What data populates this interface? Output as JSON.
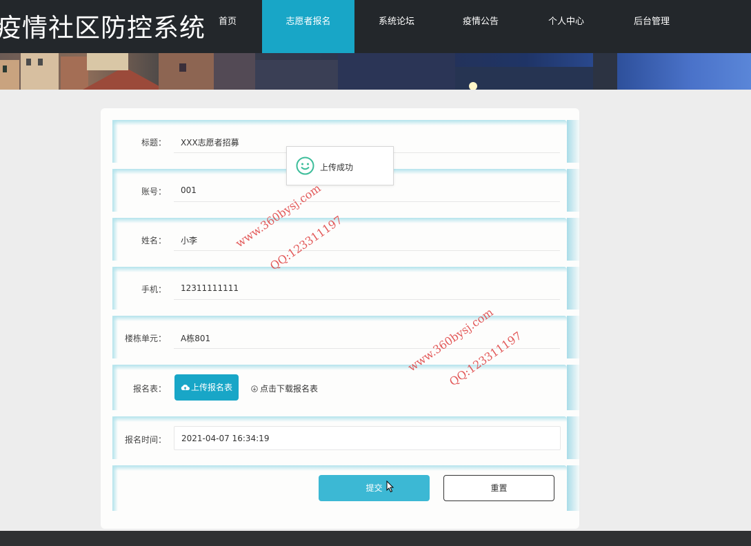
{
  "header": {
    "site_title": "疫情社区防控系统",
    "nav": [
      {
        "label": "首页",
        "active": false
      },
      {
        "label": "志愿者报名",
        "active": true
      },
      {
        "label": "系统论坛",
        "active": false
      },
      {
        "label": "疫情公告",
        "active": false
      },
      {
        "label": "个人中心",
        "active": false
      },
      {
        "label": "后台管理",
        "active": false
      }
    ]
  },
  "form": {
    "title": {
      "label": "标题：",
      "value": "XXX志愿者招募"
    },
    "account": {
      "label": "账号：",
      "value": "001"
    },
    "name": {
      "label": "姓名：",
      "value": "小李"
    },
    "phone": {
      "label": "手机：",
      "value": "12311111111"
    },
    "unit": {
      "label": "楼栋单元：",
      "value": "A栋801"
    },
    "signup_form": {
      "label": "报名表：",
      "upload_label": "上传报名表",
      "download_label": "点击下载报名表"
    },
    "signup_time": {
      "label": "报名时间：",
      "value": "2021-04-07 16:34:19"
    },
    "submit_label": "提交",
    "reset_label": "重置"
  },
  "toast": {
    "message": "上传成功"
  },
  "watermark": {
    "site": "www.360bysj.com",
    "qq": "QQ:123311197"
  },
  "colors": {
    "accent": "#18a6c7",
    "nav_bg": "#23272b",
    "watermark": "#e04848"
  }
}
